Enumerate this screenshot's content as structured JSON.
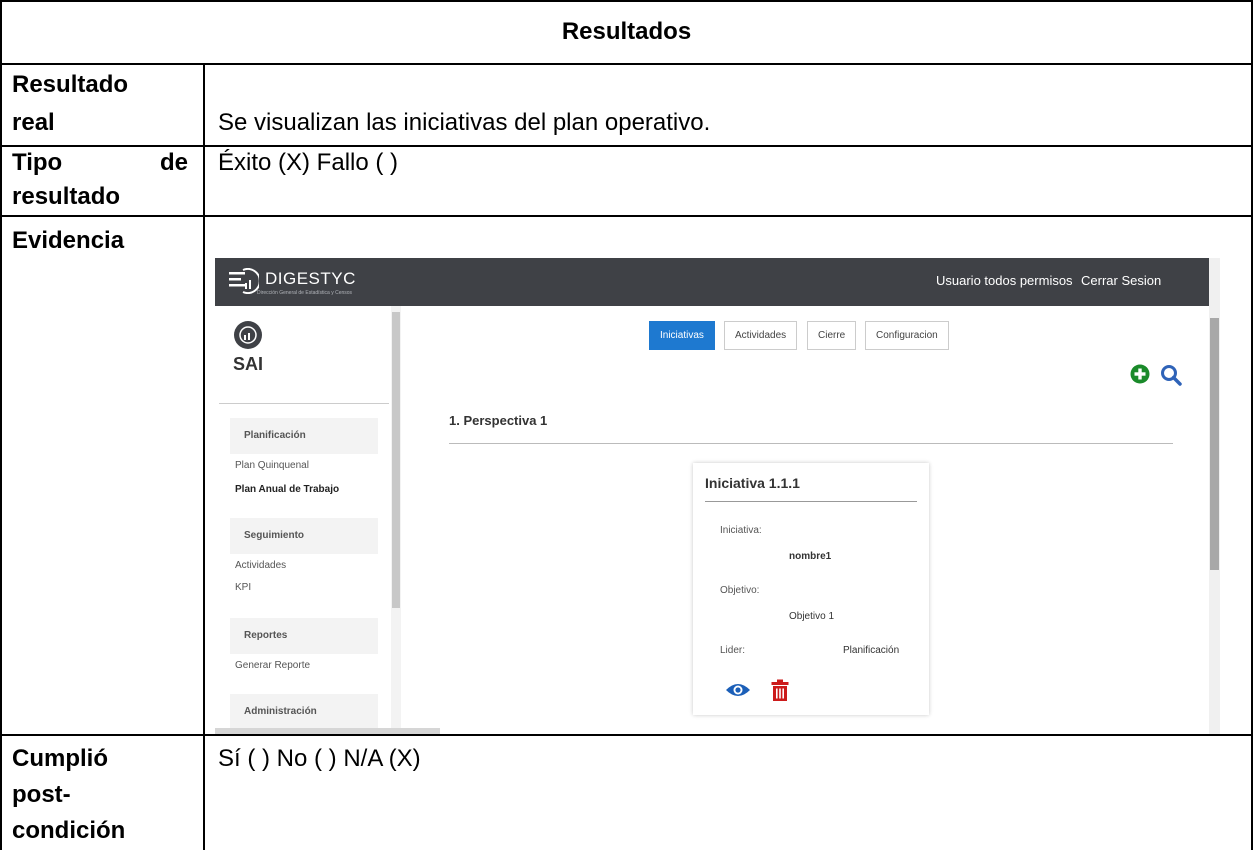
{
  "table": {
    "header": "Resultados",
    "rows": {
      "resultado_real": {
        "label_line1": "Resultado",
        "label_line2": "real",
        "value": "Se visualizan las iniciativas del plan operativo."
      },
      "tipo": {
        "label_line1a": "Tipo",
        "label_line1b": "de",
        "label_line2": "resultado",
        "value": "Éxito (X) Fallo ( )"
      },
      "evidencia": {
        "label": "Evidencia"
      },
      "cumplio": {
        "label_line1": "Cumplió",
        "label_line2": "post-",
        "label_line3": "condición",
        "value": "Sí ( )  No ( )  N/A (X)"
      }
    }
  },
  "screenshot": {
    "topbar": {
      "logo_text": "DIGESTYC",
      "logo_subtitle": "Dirección General de Estadística y Censos",
      "user": "Usuario todos permisos",
      "logout": "Cerrar Sesion"
    },
    "sidebar": {
      "app_name": "SAI",
      "sections": [
        {
          "title": "Planificación",
          "items": [
            "Plan Quinquenal",
            "Plan Anual de Trabajo"
          ]
        },
        {
          "title": "Seguimiento",
          "items": [
            "Actividades",
            "KPI"
          ]
        },
        {
          "title": "Reportes",
          "items": [
            "Generar Reporte"
          ]
        },
        {
          "title": "Administración",
          "items": []
        }
      ],
      "active_item": "Plan Anual de Trabajo"
    },
    "tabs": [
      "Iniciativas",
      "Actividades",
      "Cierre",
      "Configuracion"
    ],
    "active_tab": "Iniciativas",
    "perspective_title": "1. Perspectiva 1",
    "card": {
      "title": "Iniciativa 1.1.1",
      "initiative_label": "Iniciativa:",
      "initiative_value": "nombre1",
      "objective_label": "Objetivo:",
      "objective_value": "Objetivo 1",
      "leader_label": "Lider:",
      "leader_value": "Planificación"
    },
    "icons": [
      "plus-circle-icon",
      "search-icon",
      "eye-icon",
      "trash-icon"
    ],
    "colors": {
      "topbar": "#3f4146",
      "tab_active": "#1e79d0",
      "plus": "#1a8a2a",
      "search": "#2f63b8",
      "eye": "#1b5fb8",
      "trash": "#cc1b1b"
    }
  }
}
